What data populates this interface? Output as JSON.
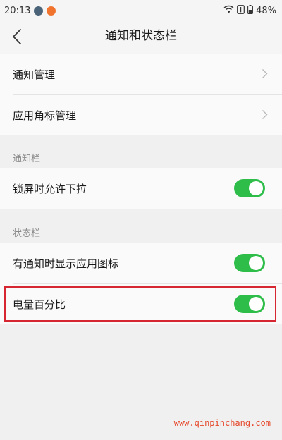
{
  "status_bar": {
    "time": "20:13",
    "battery": "48%",
    "app_icon_colors": [
      "#4a6378",
      "#f0742e"
    ]
  },
  "header": {
    "title": "通知和状态栏"
  },
  "top_group": {
    "items": [
      {
        "label": "通知管理"
      },
      {
        "label": "应用角标管理"
      }
    ]
  },
  "notification_bar": {
    "section_title": "通知栏",
    "items": [
      {
        "label": "锁屏时允许下拉",
        "enabled": true
      }
    ]
  },
  "status_bar_section": {
    "section_title": "状态栏",
    "items": [
      {
        "label": "有通知时显示应用图标",
        "enabled": true
      },
      {
        "label": "电量百分比",
        "enabled": true
      }
    ]
  },
  "colors": {
    "toggle_on": "#2fbd4a",
    "highlight_border": "#d62631",
    "watermark": "#e64a2e"
  },
  "watermark": "www.qinpinchang.com"
}
